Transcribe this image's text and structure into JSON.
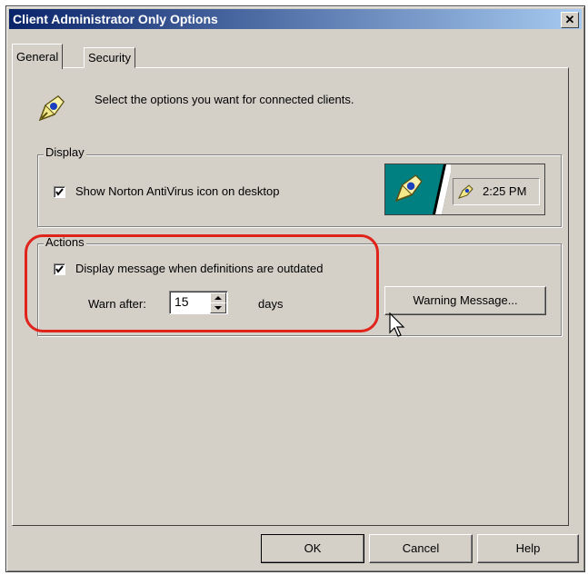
{
  "window": {
    "title": "Client Administrator Only Options",
    "close_glyph": "✕"
  },
  "tabs": [
    {
      "label": "General",
      "selected": true
    },
    {
      "label": "Security",
      "selected": false
    }
  ],
  "intro": {
    "text": "Select the options you want for connected clients.",
    "icon": "norton-shield-icon"
  },
  "display_group": {
    "legend": "Display",
    "show_icon_checkbox": {
      "label": "Show Norton AntiVirus icon on desktop",
      "checked": true
    },
    "preview": {
      "time": "2:25 PM"
    }
  },
  "actions_group": {
    "legend": "Actions",
    "outdated_checkbox": {
      "label": "Display message when definitions are outdated",
      "checked": true
    },
    "warn_after_label": "Warn after:",
    "warn_after_value": "15",
    "days_label": "days",
    "warning_message_button": "Warning Message..."
  },
  "footer": {
    "ok": "OK",
    "cancel": "Cancel",
    "help": "Help"
  },
  "colors": {
    "dialog": "#d4d0c8",
    "titlebar_start": "#0a246a",
    "titlebar_end": "#a6caf0",
    "desktop_teal": "#008080",
    "highlight": "#e0231b"
  }
}
